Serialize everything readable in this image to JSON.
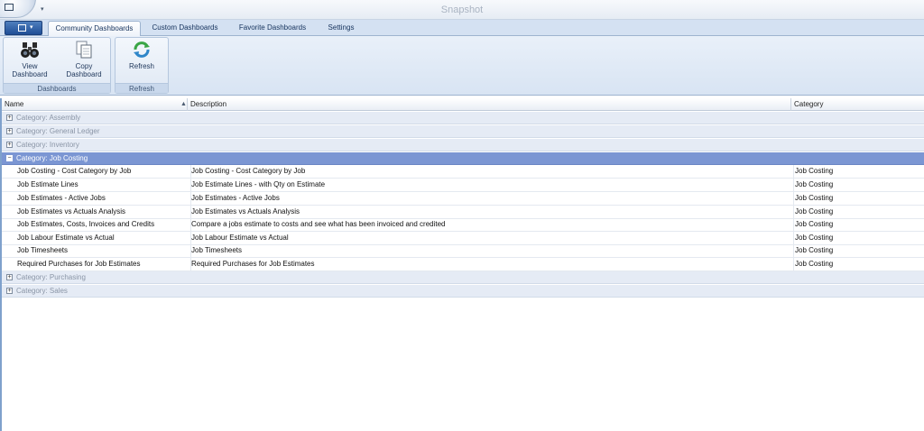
{
  "window": {
    "title": "Snapshot"
  },
  "ribbon_tabs": [
    {
      "label": "Community Dashboards",
      "active": true
    },
    {
      "label": "Custom Dashboards",
      "active": false
    },
    {
      "label": "Favorite Dashboards",
      "active": false
    },
    {
      "label": "Settings",
      "active": false
    }
  ],
  "ribbon": {
    "dashboards_group": {
      "label": "Dashboards",
      "view_button": {
        "line1": "View",
        "line2": "Dashboard",
        "icon": "binoculars-icon"
      },
      "copy_button": {
        "line1": "Copy",
        "line2": "Dashboard",
        "icon": "copy-document-icon"
      }
    },
    "refresh_group": {
      "label": "Refresh",
      "refresh_button": {
        "label": "Refresh",
        "icon": "refresh-arrows-icon"
      }
    }
  },
  "grid": {
    "columns": {
      "name": "Name",
      "description": "Description",
      "category": "Category"
    },
    "sort": {
      "column": "Name",
      "direction": "ascending"
    },
    "groups_before": [
      {
        "label": "Category: Assembly"
      },
      {
        "label": "Category: General Ledger"
      },
      {
        "label": "Category: Inventory"
      }
    ],
    "expanded_group": {
      "label": "Category: Job Costing"
    },
    "rows": [
      {
        "name": "Job Costing - Cost Category by Job",
        "description": "Job Costing - Cost Category by Job",
        "category": "Job Costing"
      },
      {
        "name": "Job Estimate Lines",
        "description": "Job Estimate Lines - with Qty on Estimate",
        "category": "Job Costing"
      },
      {
        "name": "Job Estimates - Active Jobs",
        "description": "Job Estimates - Active Jobs",
        "category": "Job Costing"
      },
      {
        "name": "Job Estimates vs Actuals Analysis",
        "description": "Job Estimates vs Actuals Analysis",
        "category": "Job Costing"
      },
      {
        "name": "Job Estimates, Costs, Invoices and Credits",
        "description": "Compare a jobs estimate to costs and see what has been invoiced and credited",
        "category": "Job Costing"
      },
      {
        "name": "Job Labour Estimate vs Actual",
        "description": "Job Labour Estimate vs Actual",
        "category": "Job Costing"
      },
      {
        "name": "Job Timesheets",
        "description": "Job Timesheets",
        "category": "Job Costing"
      },
      {
        "name": "Required Purchases for Job Estimates",
        "description": "Required Purchases for Job Estimates",
        "category": "Job Costing"
      }
    ],
    "groups_after": [
      {
        "label": "Category: Purchasing"
      },
      {
        "label": "Category: Sales"
      }
    ]
  },
  "colors": {
    "accent": "#7b96d3",
    "group_row_bg": "#e5ebf5",
    "ribbon_bg": "#d8e4f3"
  }
}
